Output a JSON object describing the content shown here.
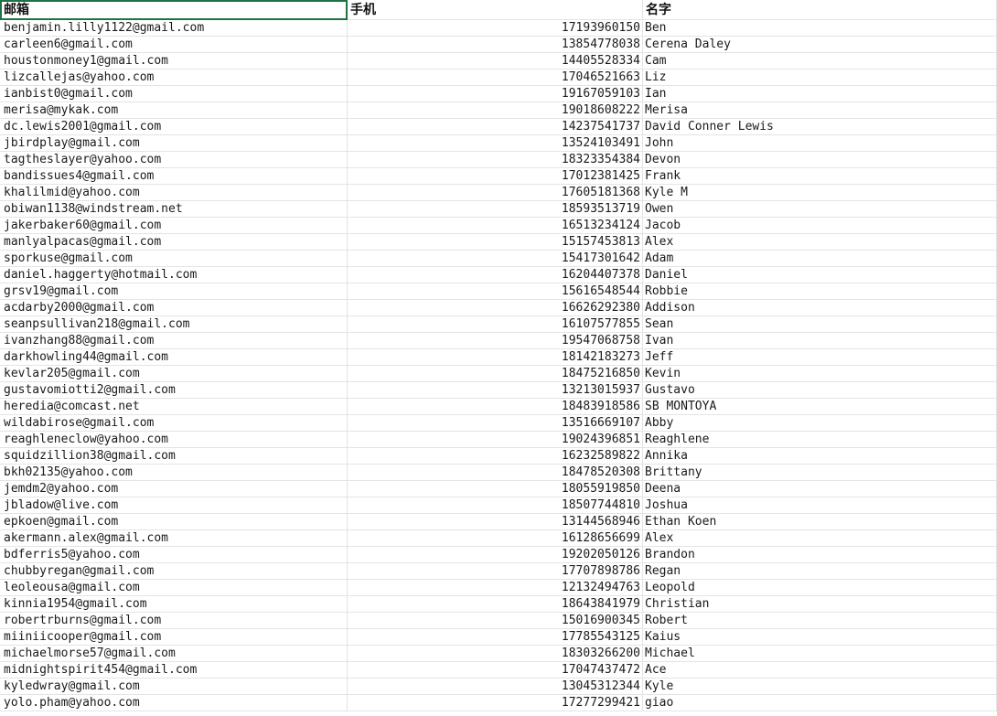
{
  "sheet": {
    "headers": {
      "email": "邮箱",
      "phone": "手机",
      "name": "名字"
    },
    "rows": [
      {
        "email": "benjamin.lilly1122@gmail.com",
        "phone": "17193960150",
        "name": "Ben"
      },
      {
        "email": "carleen6@gmail.com",
        "phone": "13854778038",
        "name": "Cerena Daley"
      },
      {
        "email": "houstonmoney1@gmail.com",
        "phone": "14405528334",
        "name": "Cam"
      },
      {
        "email": "lizcallejas@yahoo.com",
        "phone": "17046521663",
        "name": "Liz"
      },
      {
        "email": "ianbist0@gmail.com",
        "phone": "19167059103",
        "name": "Ian"
      },
      {
        "email": "merisa@mykak.com",
        "phone": "19018608222",
        "name": "Merisa"
      },
      {
        "email": "dc.lewis2001@gmail.com",
        "phone": "14237541737",
        "name": "David Conner Lewis"
      },
      {
        "email": "jbirdplay@gmail.com",
        "phone": "13524103491",
        "name": "John"
      },
      {
        "email": "tagtheslayer@yahoo.com",
        "phone": "18323354384",
        "name": "Devon"
      },
      {
        "email": "bandissues4@gmail.com",
        "phone": "17012381425",
        "name": "Frank"
      },
      {
        "email": "khalilmid@yahoo.com",
        "phone": "17605181368",
        "name": "Kyle M"
      },
      {
        "email": "obiwan1138@windstream.net",
        "phone": "18593513719",
        "name": "Owen"
      },
      {
        "email": "jakerbaker60@gmail.com",
        "phone": "16513234124",
        "name": "Jacob"
      },
      {
        "email": "manlyalpacas@gmail.com",
        "phone": "15157453813",
        "name": "Alex"
      },
      {
        "email": "sporkuse@gmail.com",
        "phone": "15417301642",
        "name": "Adam"
      },
      {
        "email": "daniel.haggerty@hotmail.com",
        "phone": "16204407378",
        "name": "Daniel"
      },
      {
        "email": "grsv19@gmail.com",
        "phone": "15616548544",
        "name": "Robbie"
      },
      {
        "email": "acdarby2000@gmail.com",
        "phone": "16626292380",
        "name": "Addison"
      },
      {
        "email": "seanpsullivan218@gmail.com",
        "phone": "16107577855",
        "name": "Sean"
      },
      {
        "email": "ivanzhang88@gmail.com",
        "phone": "19547068758",
        "name": "Ivan"
      },
      {
        "email": "darkhowling44@gmail.com",
        "phone": "18142183273",
        "name": "Jeff"
      },
      {
        "email": "kevlar205@gmail.com",
        "phone": "18475216850",
        "name": "Kevin"
      },
      {
        "email": "gustavomiotti2@gmail.com",
        "phone": "13213015937",
        "name": "Gustavo"
      },
      {
        "email": "heredia@comcast.net",
        "phone": "18483918586",
        "name": "SB MONTOYA"
      },
      {
        "email": "wildabirose@gmail.com",
        "phone": "13516669107",
        "name": "Abby"
      },
      {
        "email": "reaghleneclow@yahoo.com",
        "phone": "19024396851",
        "name": "Reaghlene"
      },
      {
        "email": "squidzillion38@gmail.com",
        "phone": "16232589822",
        "name": "Annika"
      },
      {
        "email": "bkh02135@yahoo.com",
        "phone": "18478520308",
        "name": "Brittany"
      },
      {
        "email": "jemdm2@yahoo.com",
        "phone": "18055919850",
        "name": "Deena"
      },
      {
        "email": "jbladow@live.com",
        "phone": "18507744810",
        "name": "Joshua"
      },
      {
        "email": "epkoen@gmail.com",
        "phone": "13144568946",
        "name": "Ethan Koen"
      },
      {
        "email": "akermann.alex@gmail.com",
        "phone": "16128656699",
        "name": "Alex"
      },
      {
        "email": "bdferris5@yahoo.com",
        "phone": "19202050126",
        "name": "Brandon"
      },
      {
        "email": "chubbyregan@gmail.com",
        "phone": "17707898786",
        "name": "Regan"
      },
      {
        "email": "leoleousa@gmail.com",
        "phone": "12132494763",
        "name": "Leopold"
      },
      {
        "email": "kinnia1954@gmail.com",
        "phone": "18643841979",
        "name": "Christian"
      },
      {
        "email": "robertrburns@gmail.com",
        "phone": "15016900345",
        "name": "Robert"
      },
      {
        "email": "miiniicooper@gmail.com",
        "phone": "17785543125",
        "name": "Kaius"
      },
      {
        "email": "michaelmorse57@gmail.com",
        "phone": "18303266200",
        "name": "Michael"
      },
      {
        "email": "midnightspirit454@gmail.com",
        "phone": "17047437472",
        "name": "Ace"
      },
      {
        "email": "kyledwray@gmail.com",
        "phone": "13045312344",
        "name": "Kyle"
      },
      {
        "email": "yolo.pham@yahoo.com",
        "phone": "17277299421",
        "name": "giao"
      }
    ]
  }
}
